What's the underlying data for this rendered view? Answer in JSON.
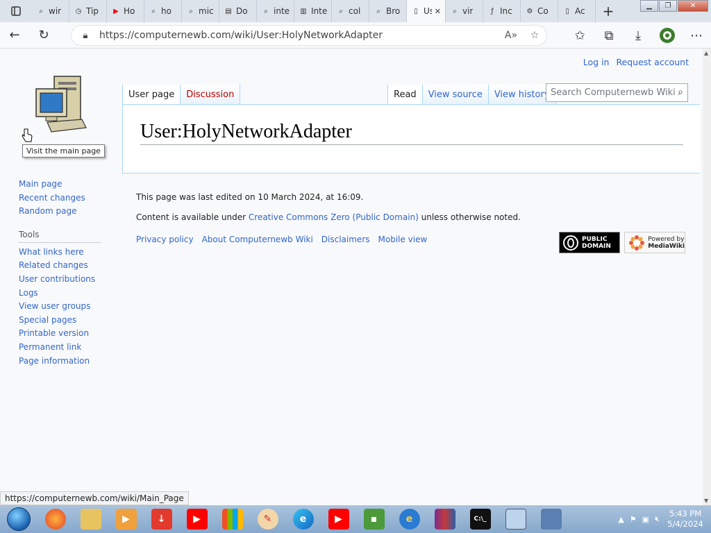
{
  "browser": {
    "tabs": [
      {
        "label": "wir",
        "icon": "search-icon"
      },
      {
        "label": "Tip",
        "icon": "clock-icon"
      },
      {
        "label": "Ho",
        "icon": "youtube-icon"
      },
      {
        "label": "ho",
        "icon": "search-icon"
      },
      {
        "label": "mic",
        "icon": "search-icon"
      },
      {
        "label": "Do",
        "icon": "document-icon"
      },
      {
        "label": "inte",
        "icon": "search-icon"
      },
      {
        "label": "Inte",
        "icon": "archive-icon"
      },
      {
        "label": "col",
        "icon": "search-icon"
      },
      {
        "label": "Bro",
        "icon": "search-icon"
      },
      {
        "label": "Use",
        "icon": "page-icon",
        "active": true
      },
      {
        "label": "vir",
        "icon": "search-icon"
      },
      {
        "label": "Inc",
        "icon": "fedora-icon"
      },
      {
        "label": "Co",
        "icon": "gear-icon"
      },
      {
        "label": "Ac",
        "icon": "page-icon"
      }
    ],
    "url": "https://computernewb.com/wiki/User:HolyNetworkAdapter",
    "status_url": "https://computernewb.com/wiki/Main_Page"
  },
  "wiki": {
    "personal": {
      "login": "Log in",
      "request": "Request account"
    },
    "tabs_left": {
      "user_page": "User page",
      "discussion": "Discussion"
    },
    "tabs_right": {
      "read": "Read",
      "view_source": "View source",
      "view_history": "View history"
    },
    "search_placeholder": "Search Computernewb Wiki",
    "tooltip": "Visit the main page",
    "title": "User:HolyNetworkAdapter",
    "nav": [
      "Main page",
      "Recent changes",
      "Random page"
    ],
    "tools_header": "Tools",
    "tools": [
      "What links here",
      "Related changes",
      "User contributions",
      "Logs",
      "View user groups",
      "Special pages",
      "Printable version",
      "Permanent link",
      "Page information"
    ],
    "footer": {
      "last_edited": "This page was last edited on 10 March 2024, at 16:09.",
      "content_prefix": "Content is available under ",
      "license": "Creative Commons Zero (Public Domain)",
      "content_suffix": " unless otherwise noted.",
      "places": [
        "Privacy policy",
        "About Computernewb Wiki",
        "Disclaimers",
        "Mobile view"
      ],
      "badge_pd": [
        "PUBLIC",
        "DOMAIN"
      ],
      "badge_mw": [
        "Powered by",
        "MediaWiki"
      ]
    }
  },
  "taskbar": {
    "time": "5:43 PM",
    "date": "5/4/2024"
  }
}
